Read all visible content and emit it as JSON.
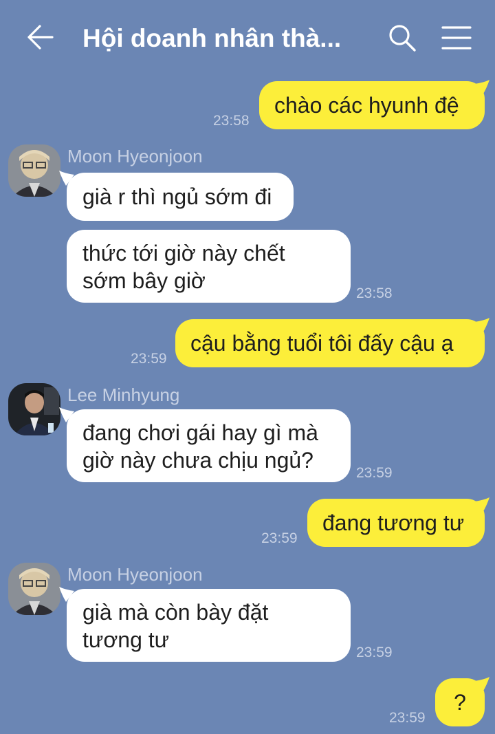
{
  "header": {
    "title": "Hội doanh nhân thà...",
    "back_icon": "arrow-left-icon",
    "search_icon": "search-icon",
    "menu_icon": "hamburger-menu-icon"
  },
  "colors": {
    "background": "#6b86b4",
    "outgoing_bubble": "#fcee3a",
    "incoming_bubble": "#ffffff"
  },
  "messages": [
    {
      "direction": "out",
      "text": "chào các hyunh đệ",
      "time": "23:58"
    },
    {
      "direction": "in",
      "sender": "Moon Hyeonjoon",
      "text": "già r thì ngủ sớm đi"
    },
    {
      "direction": "in",
      "text": "thức tới giờ này chết\nsớm bây giờ",
      "time": "23:58"
    },
    {
      "direction": "out",
      "text": "cậu bằng tuổi tôi đấy cậu ạ",
      "time": "23:59"
    },
    {
      "direction": "in",
      "sender": "Lee Minhyung",
      "text": "đang chơi gái hay gì mà\ngiờ này chưa chịu ngủ?",
      "time": "23:59"
    },
    {
      "direction": "out",
      "text": "đang tương tư",
      "time": "23:59"
    },
    {
      "direction": "in",
      "sender": "Moon Hyeonjoon",
      "text": "già mà còn bày đặt\ntương tư",
      "time": "23:59"
    },
    {
      "direction": "out",
      "text": "?",
      "time": "23:59"
    }
  ]
}
